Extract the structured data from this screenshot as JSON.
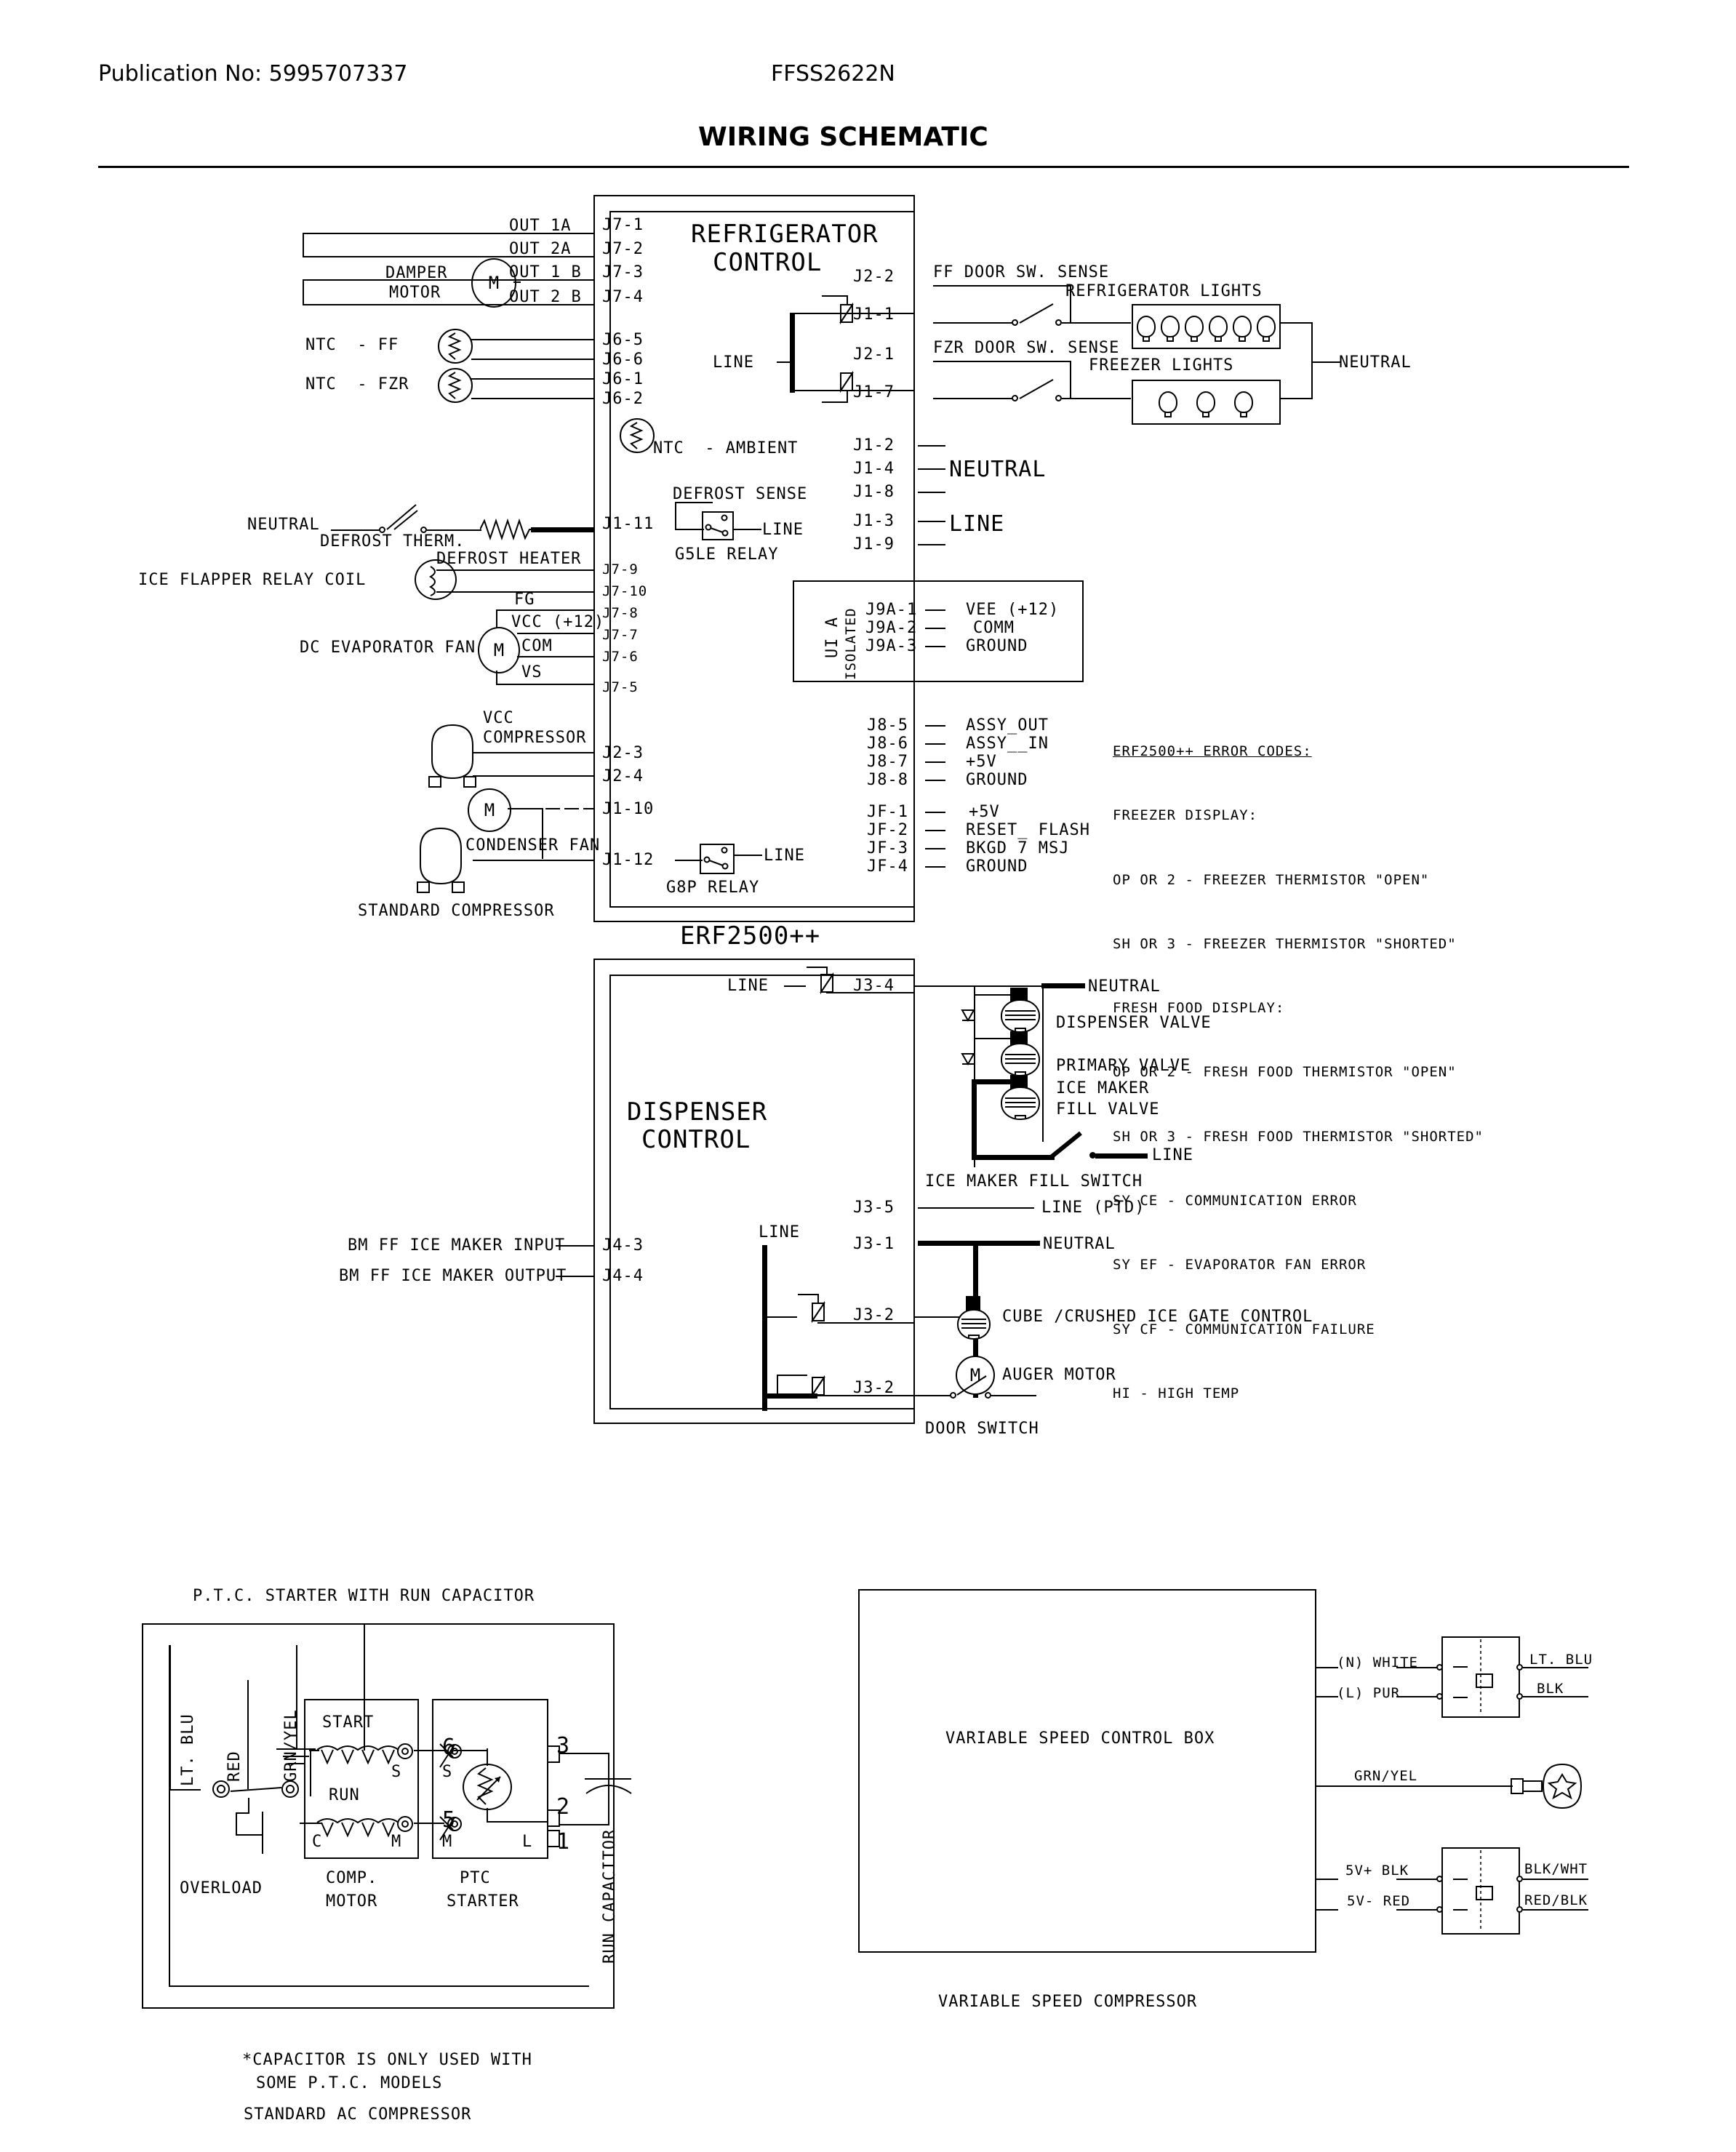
{
  "header": {
    "publication": "Publication No: 5995707337",
    "model": "FFSS2622N",
    "title": "WIRING SCHEMATIC"
  },
  "refrigerator_control": {
    "title_line1": "REFRIGERATOR",
    "title_line2": "CONTROL",
    "board_label": "ERF2500++"
  },
  "damper": {
    "label_line1": "DAMPER",
    "label_line2": "MOTOR",
    "motor_glyph": "M",
    "outputs": [
      "OUT 1A",
      "OUT 2A",
      "OUT 1 B",
      "OUT 2 B"
    ],
    "pins": [
      "J7-1",
      "J7-2",
      "J7-3",
      "J7-4"
    ]
  },
  "thermistors": {
    "ntc_ff_label": "NTC  - FF",
    "ntc_ff_pins": [
      "J6-5",
      "J6-6"
    ],
    "ntc_fzr_label": "NTC  - FZR",
    "ntc_fzr_pins": [
      "J6-1",
      "J6-2"
    ],
    "ntc_ambient_label": "NTC  - AMBIENT"
  },
  "door_sense": {
    "line_label": "LINE",
    "ff_pin": "J2-2",
    "ff_sense": "FF DOOR SW. SENSE",
    "ff_light_pin": "J1-1",
    "refrigerator_lights": "REFRIGERATOR LIGHTS",
    "refrigerator_bulb_count": 6,
    "fzr_pin": "J2-1",
    "fzr_sense": "FZR DOOR SW. SENSE",
    "fzr_light_pin": "J1-7",
    "freezer_lights": "FREEZER LIGHTS",
    "freezer_bulb_count": 3,
    "neutral": "NEUTRAL"
  },
  "power_pins": {
    "neutral_pins": [
      "J1-2",
      "J1-4",
      "J1-8"
    ],
    "neutral_label": "NEUTRAL",
    "line_pins": [
      "J1-3",
      "J1-9"
    ],
    "line_label": "LINE"
  },
  "defrost": {
    "neutral": "NEUTRAL",
    "therm_label": "DEFROST THERM.",
    "heater_label": "DEFROST HEATER",
    "pin": "J1-11",
    "sense_label": "DEFROST SENSE",
    "relay_line_label": "LINE",
    "relay_label": "G5LE RELAY"
  },
  "ice_flapper": {
    "label": "ICE FLAPPER RELAY COIL",
    "pins": [
      "J7-9",
      "J7-10"
    ]
  },
  "evaporator_fan": {
    "label": "DC EVAPORATOR FAN",
    "motor_glyph": "M",
    "signals": [
      "FG",
      "VCC (+12)",
      "COM",
      "VS"
    ],
    "pins": [
      "J7-8",
      "J7-7",
      "J7-6",
      "J7-5"
    ]
  },
  "compressors": {
    "vcc_label_line1": "VCC",
    "vcc_label_line2": "COMPRESSOR",
    "vcc_pins": [
      "J2-3",
      "J2-4"
    ],
    "condenser_fan_label": "CONDENSER FAN",
    "condenser_fan_glyph": "M",
    "condenser_pin": "J1-10",
    "standard_label": "STANDARD COMPRESSOR",
    "standard_pin": "J1-12",
    "g8p_relay_label": "G8P RELAY",
    "g8p_line_label": "LINE"
  },
  "ui_a": {
    "title_line1": "UI A",
    "title_line2": "ISOLATED",
    "pins": [
      "J9A-1",
      "J9A-2",
      "J9A-3"
    ],
    "signals": [
      "VEE (+12)",
      "COMM",
      "GROUND"
    ]
  },
  "assy": {
    "pins": [
      "J8-5",
      "J8-6",
      "J8-7",
      "J8-8"
    ],
    "signals": [
      "ASSY_OUT",
      "ASSY__IN",
      "+5V",
      "GROUND"
    ]
  },
  "flash": {
    "pins": [
      "JF-1",
      "JF-2",
      "JF-3",
      "JF-4"
    ],
    "signals": [
      "+5V",
      "RESET_ FLASH",
      "BKGD 7 MSJ",
      "GROUND"
    ]
  },
  "error_codes": {
    "title": "ERF2500++ ERROR CODES:",
    "lines": [
      "FREEZER DISPLAY:",
      "OP OR 2 - FREEZER THERMISTOR \"OPEN\"",
      "SH OR 3 - FREEZER THERMISTOR \"SHORTED\"",
      "FRESH FOOD DISPLAY:",
      "OP OR 2 - FRESH FOOD THERMISTOR \"OPEN\"",
      "SH OR 3 - FRESH FOOD THERMISTOR \"SHORTED\"",
      "SY CE - COMMUNICATION ERROR",
      "SY EF - EVAPORATOR FAN ERROR",
      "SY CF - COMMUNICATION FAILURE",
      "HI - HIGH TEMP"
    ]
  },
  "dispenser": {
    "title_line1": "DISPENSER",
    "title_line2": "CONTROL",
    "line_label_top": "LINE",
    "pin_j3_4": "J3-4",
    "neutral": "NEUTRAL",
    "valves": [
      "DISPENSER VALVE",
      "PRIMARY VALVE",
      "ICE MAKER",
      "FILL VALVE"
    ],
    "fill_switch_line": "LINE",
    "fill_switch_label": "ICE MAKER FILL SWITCH",
    "pin_j3_5": "J3-5",
    "line_ptd": "LINE (PTD)",
    "bm_input_label": "BM FF ICE MAKER INPUT",
    "bm_input_pin": "J4-3",
    "bm_output_label": "BM FF ICE MAKER OUTPUT",
    "bm_output_pin": "J4-4",
    "line_label_mid": "LINE",
    "pin_j3_1": "J3-1",
    "neutral_mid": "NEUTRAL",
    "pin_j3_2a": "J3-2",
    "gate_control_label": "CUBE /CRUSHED ICE GATE CONTROL",
    "auger_motor_glyph": "M",
    "auger_motor_label": "AUGER MOTOR",
    "pin_j3_2b": "J3-2",
    "door_switch_label": "DOOR SWITCH"
  },
  "ptc_starter": {
    "title": "P.T.C. STARTER WITH RUN CAPACITOR",
    "wire_lt_blu": "LT. BLU",
    "wire_red": "RED",
    "wire_grn_yel": "GRN/YEL",
    "overload_label": "OVERLOAD",
    "motor_box": {
      "start": "START",
      "run": "RUN",
      "terminal_s": "S",
      "terminal_c": "C",
      "terminal_m": "M",
      "label_line1": "COMP.",
      "label_line2": "MOTOR"
    },
    "ptc_box": {
      "num6": "6",
      "num5": "5",
      "terminal_s": "S",
      "terminal_m": "M",
      "terminal_l": "L",
      "label_line1": "PTC",
      "label_line2": "STARTER"
    },
    "cap": {
      "num3": "3",
      "num2": "2",
      "num1": "1",
      "label": "RUN CAPACITOR"
    },
    "note_line1": "*CAPACITOR IS ONLY USED WITH",
    "note_line2": "SOME P.T.C. MODELS",
    "note_line3": "STANDARD AC COMPRESSOR"
  },
  "variable_speed": {
    "box_label": "VARIABLE SPEED CONTROL BOX",
    "caption": "VARIABLE SPEED COMPRESSOR",
    "conn_top_left": [
      "(N) WHITE",
      "(L) PUR"
    ],
    "conn_top_right": [
      "LT. BLU",
      "BLK"
    ],
    "ground_wire": "GRN/YEL",
    "conn_bot_left": [
      "5V+ BLK",
      "5V- RED"
    ],
    "conn_bot_right": [
      "BLK/WHT",
      "RED/BLK"
    ]
  }
}
